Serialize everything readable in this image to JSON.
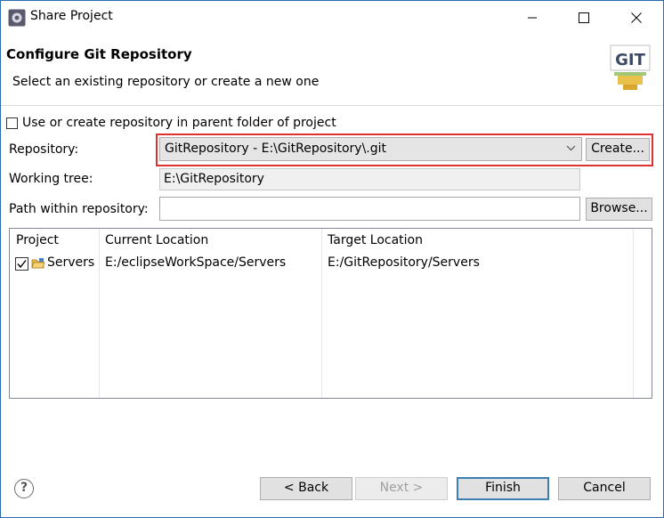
{
  "window": {
    "title": "Share Project"
  },
  "banner": {
    "title": "Configure Git Repository",
    "description": "Select an existing repository or create a new one",
    "logo_text": "GIT"
  },
  "form": {
    "parent_folder_checkbox_label": "Use or create repository in parent folder of project",
    "parent_folder_checked": false,
    "repository_label": "Repository:",
    "repository_value": "GitRepository - E:\\GitRepository\\.git",
    "create_button": "Create...",
    "working_tree_label": "Working tree:",
    "working_tree_value": "E:\\GitRepository",
    "path_label": "Path within repository:",
    "path_value": "",
    "browse_button": "Browse..."
  },
  "table": {
    "columns": [
      "Project",
      "Current Location",
      "Target Location"
    ],
    "rows": [
      {
        "checked": true,
        "project": "Servers",
        "current": "E:/eclipseWorkSpace/Servers",
        "target": "E:/GitRepository/Servers"
      }
    ]
  },
  "footer": {
    "help_icon": "?",
    "back": "< Back",
    "next": "Next >",
    "finish": "Finish",
    "cancel": "Cancel"
  },
  "colors": {
    "highlight": "#e03131",
    "default_button_border": "#3c7fb1",
    "titlebar_accent": "#2b6cb0"
  }
}
